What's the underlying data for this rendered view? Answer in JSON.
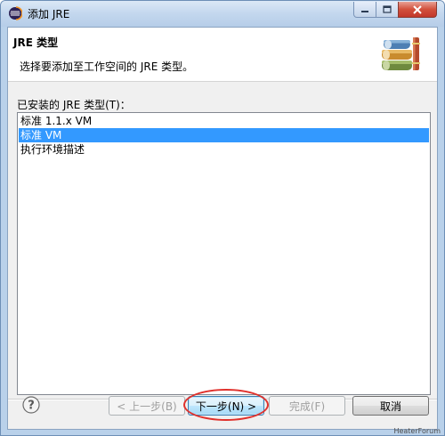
{
  "window": {
    "title": "添加 JRE"
  },
  "banner": {
    "title": "JRE 类型",
    "description": "选择要添加至工作空间的 JRE 类型。",
    "icon": "books-icon"
  },
  "list": {
    "label": "已安装的 JRE 类型(T)：",
    "items": [
      {
        "label": "标准 1.1.x VM",
        "selected": false
      },
      {
        "label": "标准 VM",
        "selected": true
      },
      {
        "label": "执行环境描述",
        "selected": false
      }
    ]
  },
  "buttons": {
    "help": "?",
    "back": "< 上一步(B)",
    "next": "下一步(N) >",
    "finish": "完成(F)",
    "cancel": "取消"
  },
  "watermark": "HeaterForum",
  "colors": {
    "selection": "#3399ff",
    "annotation_ellipse": "#e0312c"
  }
}
